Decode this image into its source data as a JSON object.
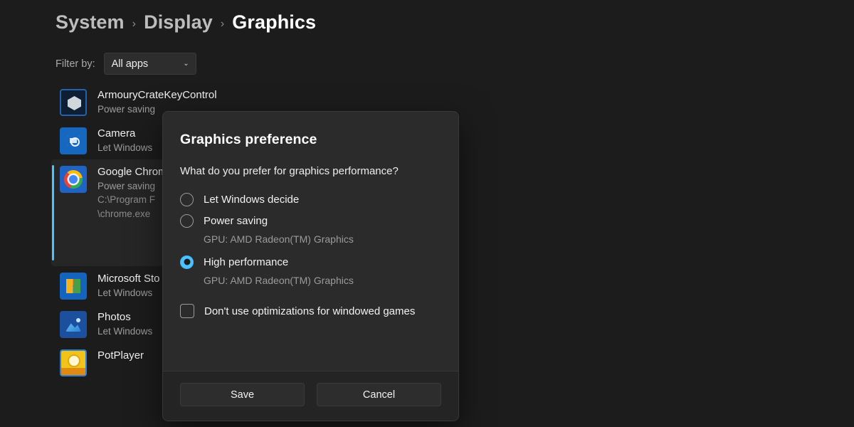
{
  "breadcrumb": {
    "items": [
      {
        "label": "System",
        "current": false
      },
      {
        "label": "Display",
        "current": false
      },
      {
        "label": "Graphics",
        "current": true
      }
    ],
    "separator": "›"
  },
  "filter": {
    "label": "Filter by:",
    "value": "All apps",
    "chevron": "⌄"
  },
  "app_list": [
    {
      "name": "ArmouryCrateKeyControl",
      "sub": "Power saving",
      "path": "",
      "icon": "armourycrate-app-icon",
      "icon_class": "ic-armoury",
      "selected": false
    },
    {
      "name": "Camera",
      "sub": "Let Windows",
      "path": "",
      "icon": "camera-app-icon",
      "icon_class": "ic-camera",
      "selected": false
    },
    {
      "name": "Google Chrom",
      "sub": "Power saving",
      "path": "C:\\Program F\n\\chrome.exe",
      "path_line1": "C:\\Program F",
      "path_line2": "\\chrome.exe",
      "icon": "google-chrome-app-icon",
      "icon_class": "ic-chrome",
      "selected": true
    },
    {
      "name": "Microsoft Sto",
      "sub": "Let Windows",
      "path": "",
      "icon": "microsoft-store-app-icon",
      "icon_class": "ic-store",
      "selected": false
    },
    {
      "name": "Photos",
      "sub": "Let Windows",
      "path": "",
      "icon": "photos-app-icon",
      "icon_class": "ic-photos",
      "selected": false
    },
    {
      "name": "PotPlayer",
      "sub": "",
      "path": "",
      "icon": "potplayer-app-icon",
      "icon_class": "ic-potplayer",
      "selected": false
    }
  ],
  "dialog": {
    "title": "Graphics preference",
    "question": "What do you prefer for graphics performance?",
    "options": [
      {
        "label": "Let Windows decide",
        "gpu": "",
        "checked": false
      },
      {
        "label": "Power saving",
        "gpu": "GPU: AMD Radeon(TM) Graphics",
        "checked": false
      },
      {
        "label": "High performance",
        "gpu": "GPU: AMD Radeon(TM) Graphics",
        "checked": true
      }
    ],
    "checkbox": {
      "label": "Don't use optimizations for windowed games",
      "checked": false
    },
    "save_label": "Save",
    "cancel_label": "Cancel"
  },
  "colors": {
    "page_background": "#1c1c1c",
    "dialog_background": "#2b2b2b",
    "dialog_footer": "#242424",
    "accent": "#4cc2ff",
    "text_primary": "#f0f0f0",
    "text_secondary": "#9b9b9b"
  }
}
